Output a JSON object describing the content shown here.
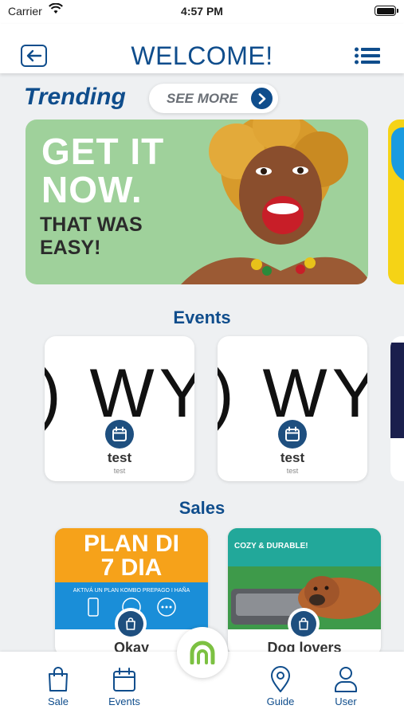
{
  "status_bar": {
    "carrier": "Carrier",
    "time": "4:57 PM"
  },
  "header": {
    "title": "WELCOME!"
  },
  "trending": {
    "title": "Trending",
    "see_more_label": "SEE MORE",
    "banner": {
      "headline_line1": "GET IT",
      "headline_line2": "NOW.",
      "sub_line1": "THAT WAS",
      "sub_line2": "EASY!"
    }
  },
  "events": {
    "title": "Events",
    "items": [
      {
        "image_text": ") WY",
        "name": "test",
        "description": "test"
      },
      {
        "image_text": ") WY",
        "name": "test",
        "description": "test"
      }
    ]
  },
  "sales": {
    "title": "Sales",
    "items": [
      {
        "name": "Okay",
        "image": {
          "line1": "PLAN DI",
          "line2": "7 DIA",
          "line3": "AKTIVÁ UN PLAN KOMBO PREPAGO I HAÑA"
        }
      },
      {
        "name": "Dog lovers",
        "image": {
          "tag": "COZY & DURABLE!"
        }
      }
    ]
  },
  "bottom_nav": {
    "items": [
      {
        "label": "Sale",
        "icon": "shopping-bag-icon"
      },
      {
        "label": "Events",
        "icon": "calendar-icon"
      },
      {
        "label": "Guide",
        "icon": "map-pin-icon"
      },
      {
        "label": "User",
        "icon": "user-icon"
      }
    ],
    "center_icon": "brand-logo-icon"
  },
  "colors": {
    "primary": "#0f4d8c",
    "icon_circle": "#1e4f7f",
    "background": "#eef0f2",
    "logo_green": "#7cc142"
  }
}
